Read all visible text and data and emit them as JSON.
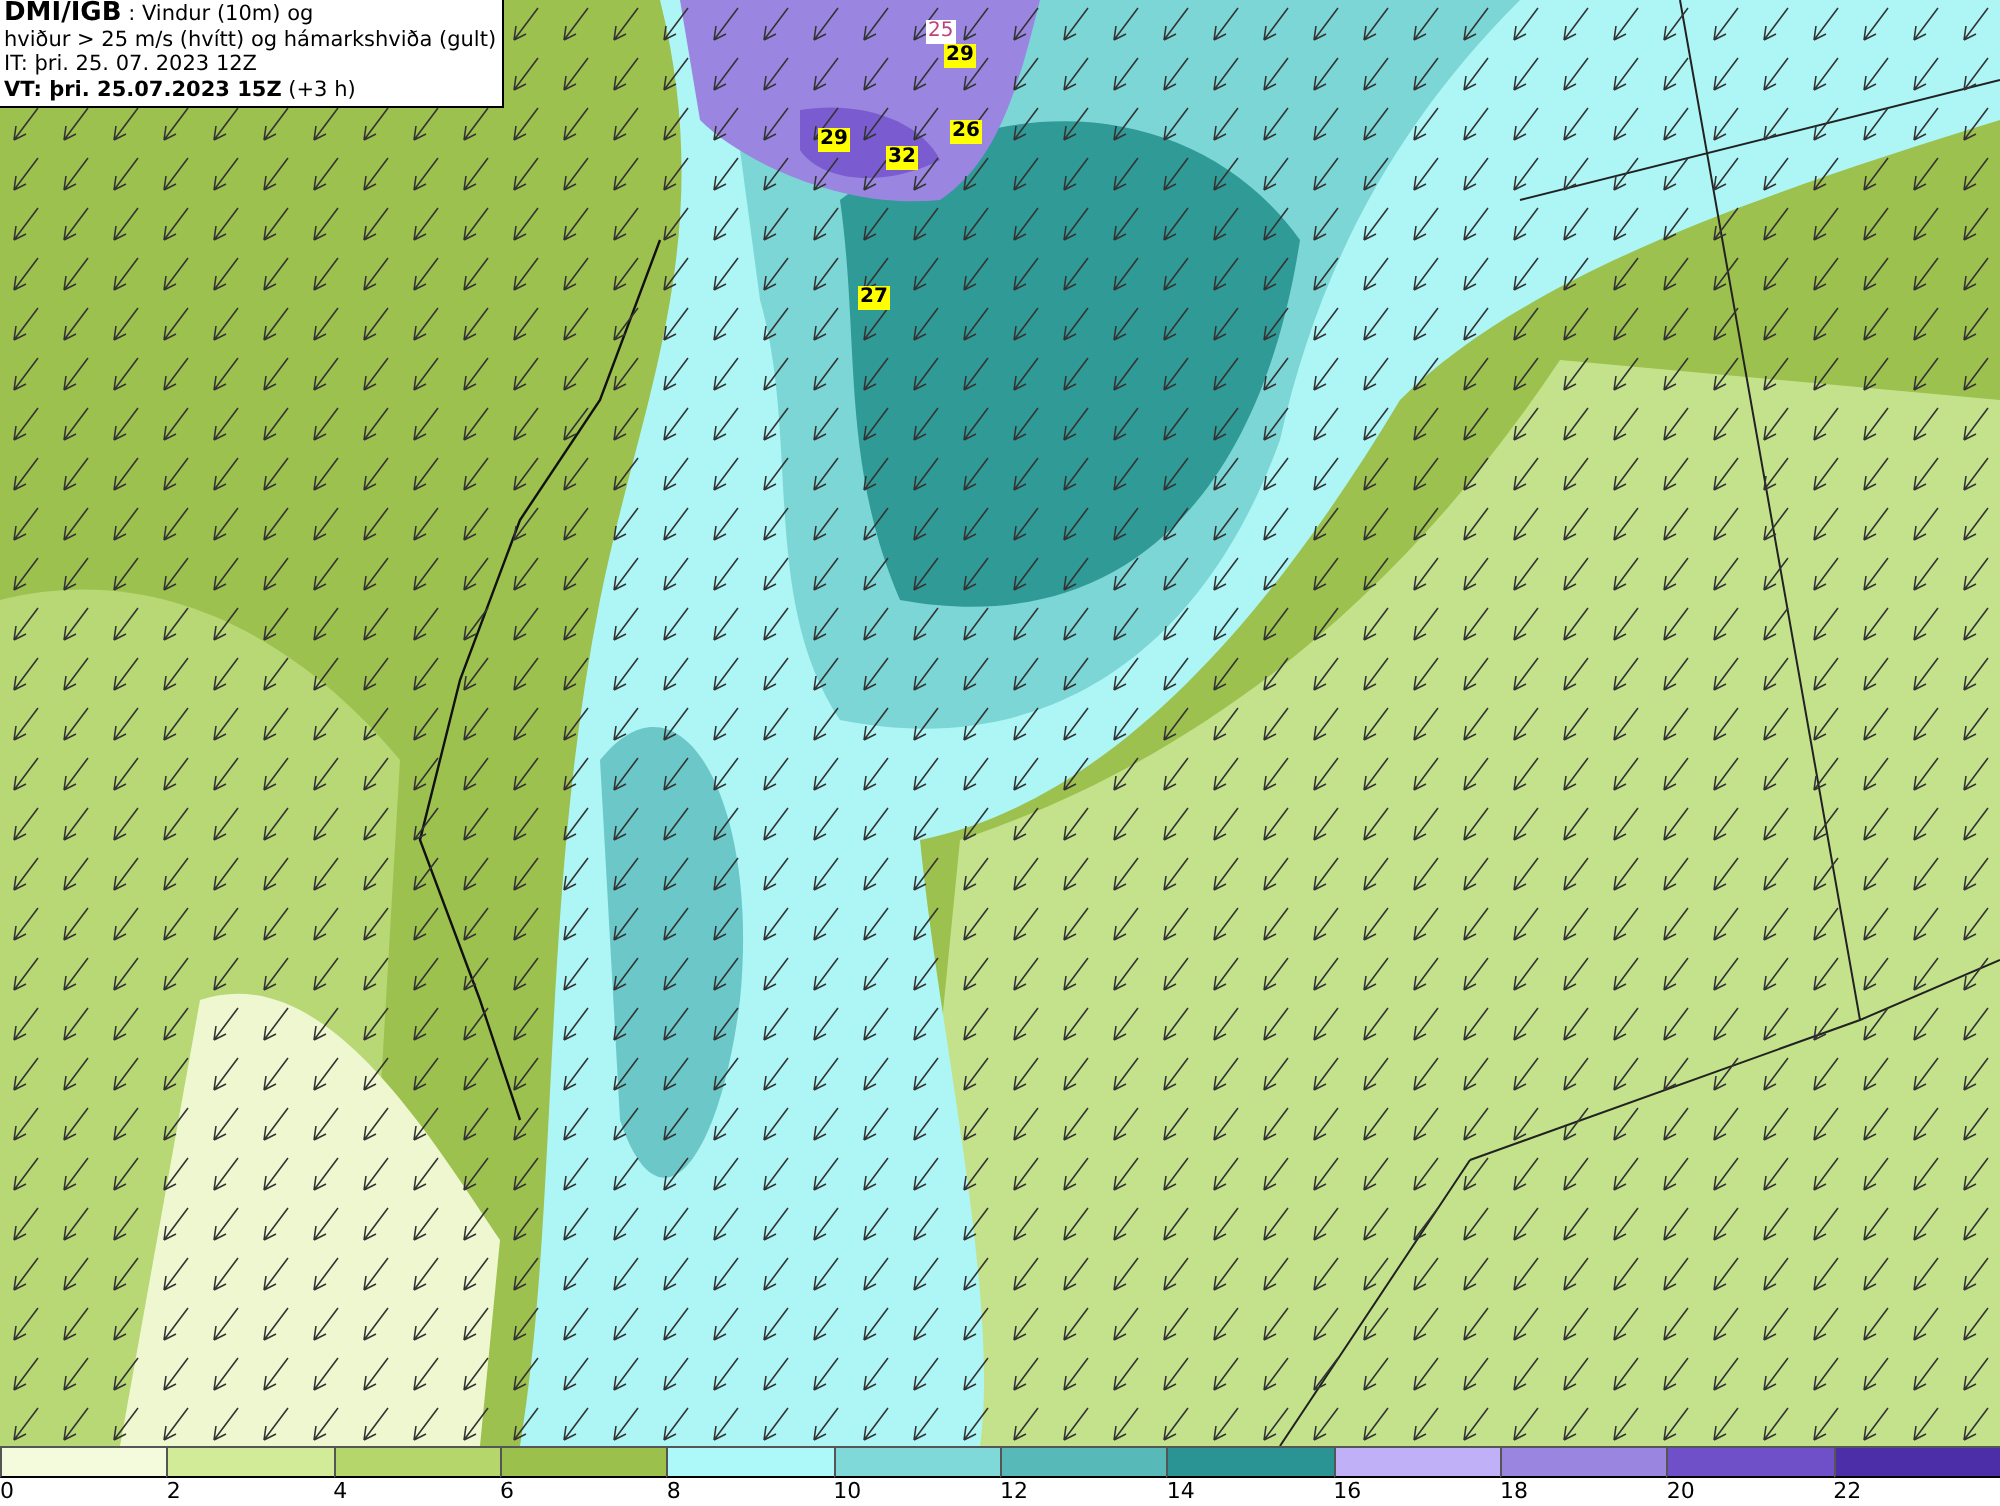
{
  "header": {
    "source": "DMI/IGB",
    "title_lines": [
      " : Vindur (10m) og",
      "hviður > 25 m/s (hvítt) og hámarkshviða (gult)",
      "IT: þri. 25. 07. 2023 12Z"
    ],
    "valid_time": "VT: þri. 25.07.2023 15Z",
    "valid_offset": " (+3 h)"
  },
  "gust_labels": [
    {
      "text": "25",
      "kind": "threshold"
    },
    {
      "text": "29",
      "kind": "max"
    },
    {
      "text": "29",
      "kind": "max"
    },
    {
      "text": "32",
      "kind": "max"
    },
    {
      "text": "26",
      "kind": "max"
    },
    {
      "text": "27",
      "kind": "max"
    }
  ],
  "legend": {
    "bins": [
      {
        "tick": "0",
        "color": "#f4fadc"
      },
      {
        "tick": "2",
        "color": "#d2eb99"
      },
      {
        "tick": "4",
        "color": "#b4d66b"
      },
      {
        "tick": "6",
        "color": "#9bc14c"
      },
      {
        "tick": "8",
        "color": "#adf8f8"
      },
      {
        "tick": "10",
        "color": "#80d9d9"
      },
      {
        "tick": "12",
        "color": "#58b9b9"
      },
      {
        "tick": "14",
        "color": "#2a9494"
      },
      {
        "tick": "16",
        "color": "#c0b0f8"
      },
      {
        "tick": "18",
        "color": "#9a85e0"
      },
      {
        "tick": "20",
        "color": "#7050c8"
      },
      {
        "tick": "22",
        "color": "#4c2fa8"
      }
    ]
  }
}
